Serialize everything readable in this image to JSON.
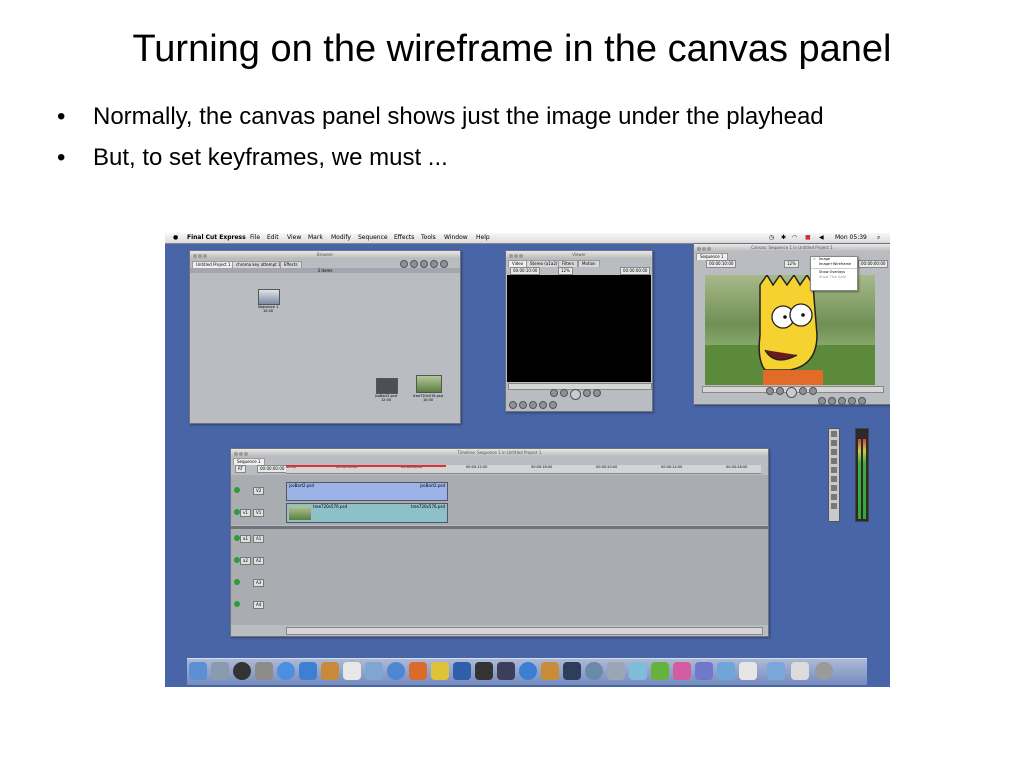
{
  "slide": {
    "title": "Turning on the wireframe in the canvas panel",
    "bullets": [
      "Normally, the canvas panel shows just the image under the playhead",
      "But, to set keyframes, we must ..."
    ]
  },
  "screenshot": {
    "menubar": {
      "app": "Final Cut Express",
      "items": [
        "File",
        "Edit",
        "View",
        "Mark",
        "Modify",
        "Sequence",
        "Effects",
        "Tools",
        "Window",
        "Help"
      ],
      "clock": "Mon 05:39"
    },
    "browser": {
      "title": "Browser",
      "tabs": [
        "Untitled Project 1",
        "chroma key attempt 1",
        "Effects"
      ],
      "count": "3 items",
      "items": [
        {
          "name": "Sequence 1",
          "duration": "10:00"
        },
        {
          "name": "jsoBart2.psd",
          "duration": "12:00"
        },
        {
          "name": "tree720x576.psd",
          "duration": "10:00"
        }
      ]
    },
    "viewer": {
      "title": "Viewer",
      "tabs": [
        "Video",
        "Stereo (a1a2)",
        "Filters",
        "Motion"
      ],
      "timecode_left": "00:00:10:00",
      "zoom": "12%",
      "timecode_right": "00:00:00:00"
    },
    "canvas": {
      "title": "Canvas: Sequence 1 in Untitled Project 1",
      "tab": "Sequence 1",
      "timecode_left": "00:00:10:00",
      "zoom": "12%",
      "timecode_right": "00:00:00:00",
      "view_menu": {
        "items": [
          "Image",
          "Image+Wireframe"
        ],
        "items2": [
          "Show Overlays",
          "Show Title Safe"
        ]
      }
    },
    "timeline": {
      "title": "Timeline: Sequence 1 in Untitled Project 1",
      "tab": "Sequence 1",
      "rt": "RT",
      "timecode": "00:00:00:00",
      "ruler": [
        "00:00",
        "00:00:04:00",
        "00:00:08:00",
        "00:00:12:00",
        "00:00:16:00",
        "00:00:20:00",
        "00:00:24:00",
        "00:00:28:00"
      ],
      "video_tracks": [
        {
          "label": "V2",
          "clip": "jsoBart2.psd",
          "clip_end": "jsoBart2.psd"
        },
        {
          "label": "V1",
          "src": "v1",
          "clip": "tree720x576.psd",
          "clip_end": "tree720x576.psd"
        }
      ],
      "audio_tracks": [
        {
          "src": "a1",
          "label": "A1"
        },
        {
          "src": "a2",
          "label": "A2"
        },
        {
          "label": "A3"
        },
        {
          "label": "A4"
        }
      ]
    },
    "colors": {
      "desktop": "#4865a8",
      "window": "#b9bcc1",
      "v2_clip": "#9bb3e6",
      "v1_clip": "#8ec0c8"
    }
  }
}
